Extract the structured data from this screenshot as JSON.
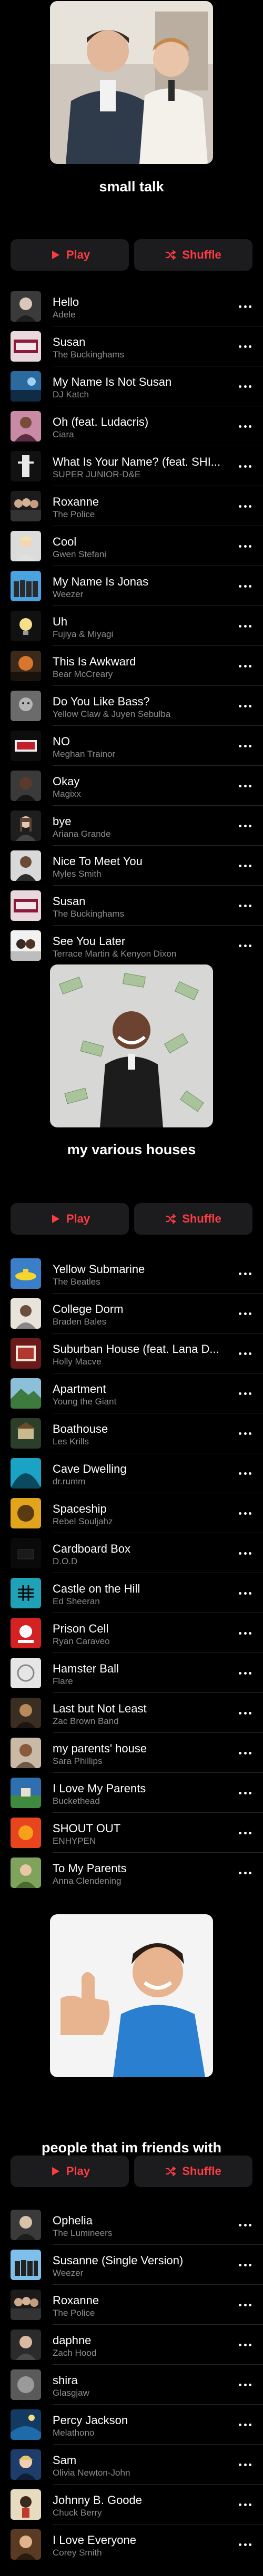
{
  "colors": {
    "background": "#000000",
    "accent": "#fc3c44",
    "button_bg": "#1c1c1e",
    "secondary_text": "#8e8e93"
  },
  "icons": {
    "play": "play-icon",
    "shuffle": "shuffle-icon",
    "more": "more-dots-icon"
  },
  "playlists": [
    {
      "title": "small talk",
      "play_label": "Play",
      "shuffle_label": "Shuffle",
      "songs": [
        {
          "title": "Hello",
          "artist": "Adele"
        },
        {
          "title": "Susan",
          "artist": "The Buckinghams"
        },
        {
          "title": "My Name Is Not Susan",
          "artist": "DJ Katch"
        },
        {
          "title": "Oh (feat. Ludacris)",
          "artist": "Ciara"
        },
        {
          "title": "What Is Your Name? (feat. SHI...",
          "artist": "SUPER JUNIOR-D&E"
        },
        {
          "title": "Roxanne",
          "artist": "The Police"
        },
        {
          "title": "Cool",
          "artist": "Gwen Stefani"
        },
        {
          "title": "My Name Is Jonas",
          "artist": "Weezer"
        },
        {
          "title": "Uh",
          "artist": "Fujiya & Miyagi"
        },
        {
          "title": "This Is Awkward",
          "artist": "Bear McCreary"
        },
        {
          "title": "Do You Like Bass?",
          "artist": "Yellow Claw & Juyen Sebulba"
        },
        {
          "title": "NO",
          "artist": "Meghan Trainor"
        },
        {
          "title": "Okay",
          "artist": "Magixx"
        },
        {
          "title": "bye",
          "artist": "Ariana Grande"
        },
        {
          "title": "Nice To Meet You",
          "artist": "Myles Smith"
        },
        {
          "title": "Susan",
          "artist": "The Buckinghams"
        },
        {
          "title": "See You Later",
          "artist": "Terrace Martin & Kenyon Dixon"
        }
      ]
    },
    {
      "title": "my various houses",
      "play_label": "Play",
      "shuffle_label": "Shuffle",
      "songs": [
        {
          "title": "Yellow Submarine",
          "artist": "The Beatles"
        },
        {
          "title": "College Dorm",
          "artist": "Braden Bales"
        },
        {
          "title": "Suburban House (feat. Lana D...",
          "artist": "Holly Macve"
        },
        {
          "title": "Apartment",
          "artist": "Young the Giant"
        },
        {
          "title": "Boathouse",
          "artist": "Les Krills"
        },
        {
          "title": "Cave Dwelling",
          "artist": "dr.rumm"
        },
        {
          "title": "Spaceship",
          "artist": "Rebel Souljahz"
        },
        {
          "title": "Cardboard Box",
          "artist": "D.O.D"
        },
        {
          "title": "Castle on the Hill",
          "artist": "Ed Sheeran"
        },
        {
          "title": "Prison Cell",
          "artist": "Ryan Caraveo"
        },
        {
          "title": "Hamster Ball",
          "artist": "Flare"
        },
        {
          "title": "Last but Not Least",
          "artist": "Zac Brown Band"
        },
        {
          "title": "my parents' house",
          "artist": "Sara Phillips"
        },
        {
          "title": "I Love My Parents",
          "artist": "Buckethead"
        },
        {
          "title": "SHOUT OUT",
          "artist": "ENHYPEN"
        },
        {
          "title": "To My Parents",
          "artist": "Anna Clendening"
        }
      ]
    },
    {
      "title": "people that im friends with",
      "play_label": "Play",
      "shuffle_label": "Shuffle",
      "songs": [
        {
          "title": "Ophelia",
          "artist": "The Lumineers"
        },
        {
          "title": "Susanne (Single Version)",
          "artist": "Weezer"
        },
        {
          "title": "Roxanne",
          "artist": "The Police"
        },
        {
          "title": "daphne",
          "artist": "Zach Hood"
        },
        {
          "title": "shira",
          "artist": "Glasgjaw"
        },
        {
          "title": "Percy Jackson",
          "artist": "Melathono"
        },
        {
          "title": "Sam",
          "artist": "Olivia Newton-John"
        },
        {
          "title": "Johnny B. Goode",
          "artist": "Chuck Berry"
        },
        {
          "title": "I Love Everyone",
          "artist": "Corey Smith"
        }
      ]
    }
  ]
}
